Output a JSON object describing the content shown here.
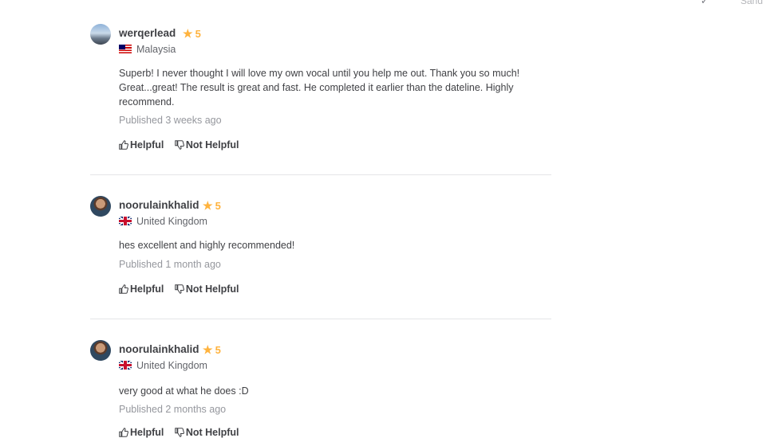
{
  "top_fragment": {
    "text": "Sand"
  },
  "reviews": [
    {
      "username": "werqerlead",
      "rating": "5",
      "country": "Malaysia",
      "text": "Superb! I never thought I will love my own vocal until you help me out. Thank you so much! Great...great! The result is great and fast. He completed it earlier than the dateline. Highly recommend.",
      "published": "Published 3 weeks ago",
      "helpful": "Helpful",
      "not_helpful": "Not Helpful"
    },
    {
      "username": "noorulainkhalid",
      "rating": "5",
      "country": "United Kingdom",
      "text": "hes excellent and highly recommended!",
      "published": "Published 1 month ago",
      "helpful": "Helpful",
      "not_helpful": "Not Helpful"
    },
    {
      "username": "noorulainkhalid",
      "rating": "5",
      "country": "United Kingdom",
      "text": "very good at what he does :D",
      "published": "Published 2 months ago",
      "helpful": "Helpful",
      "not_helpful": "Not Helpful"
    }
  ]
}
